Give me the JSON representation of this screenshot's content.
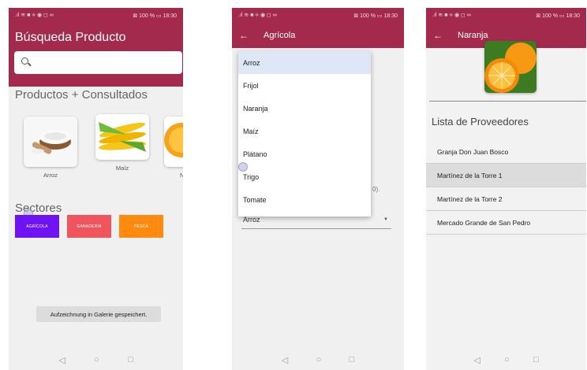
{
  "status": {
    "left": ".ıl ≋ ■ ⟡ ◉ ◻ ∞",
    "right": "⊠ 100 % ▭ 18:30"
  },
  "screen1": {
    "title": "Búsqueda Producto",
    "search_placeholder": "",
    "products_title": "Productos + Consultados",
    "products": [
      {
        "label": "Arroz"
      },
      {
        "label": "Maíz"
      },
      {
        "label": "N"
      }
    ],
    "sectors_title": "Sectores",
    "sectors": [
      {
        "label": "AGRÍCOLA",
        "color": "#6f12f5"
      },
      {
        "label": "GANADERÍA",
        "color": "#f0545c"
      },
      {
        "label": "PESCA",
        "color": "#ff8a10"
      }
    ],
    "toast": "Aufzeichnung in Galerie gespeichert."
  },
  "screen2": {
    "title": "Agrícola",
    "options": [
      "Arroz",
      "Frijol",
      "Naranja",
      "Maíz",
      "Plátano",
      "Trigo",
      "Tomate"
    ],
    "selected": "Arroz",
    "hidden_fragment": "0)."
  },
  "screen3": {
    "title": "Naranja",
    "list_title": "Lista de Proveedores",
    "providers": [
      "Granja Don Juan Bosco",
      "Martínez de la Torre 1",
      "Martínez de la Torre 2",
      "Mercado Grande de San Pedro"
    ],
    "highlighted_index": 1
  },
  "nav": {
    "back": "◁",
    "home": "○",
    "recent": "□"
  },
  "colors": {
    "primary": "#a32a4d"
  }
}
